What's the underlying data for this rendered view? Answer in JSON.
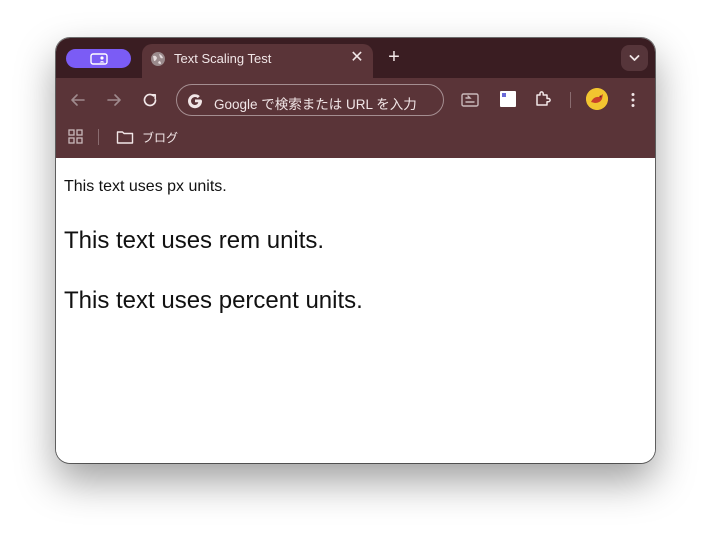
{
  "browser": {
    "tab": {
      "title": "Text Scaling Test",
      "close_glyph": "✕"
    },
    "new_tab_glyph": "+",
    "omnibox": {
      "placeholder": "Google で検索または URL を入力"
    },
    "bookmarks": [
      {
        "label": "ブログ",
        "icon": "folder-icon"
      }
    ],
    "colors": {
      "frame": "#3a1d22",
      "toolbar": "#5a3438",
      "profile_pill": "#7b5cf5",
      "avatar": "#f2c530"
    }
  },
  "page": {
    "lines": [
      "This text uses px units.",
      "This text uses rem units.",
      "This text uses percent units."
    ]
  }
}
